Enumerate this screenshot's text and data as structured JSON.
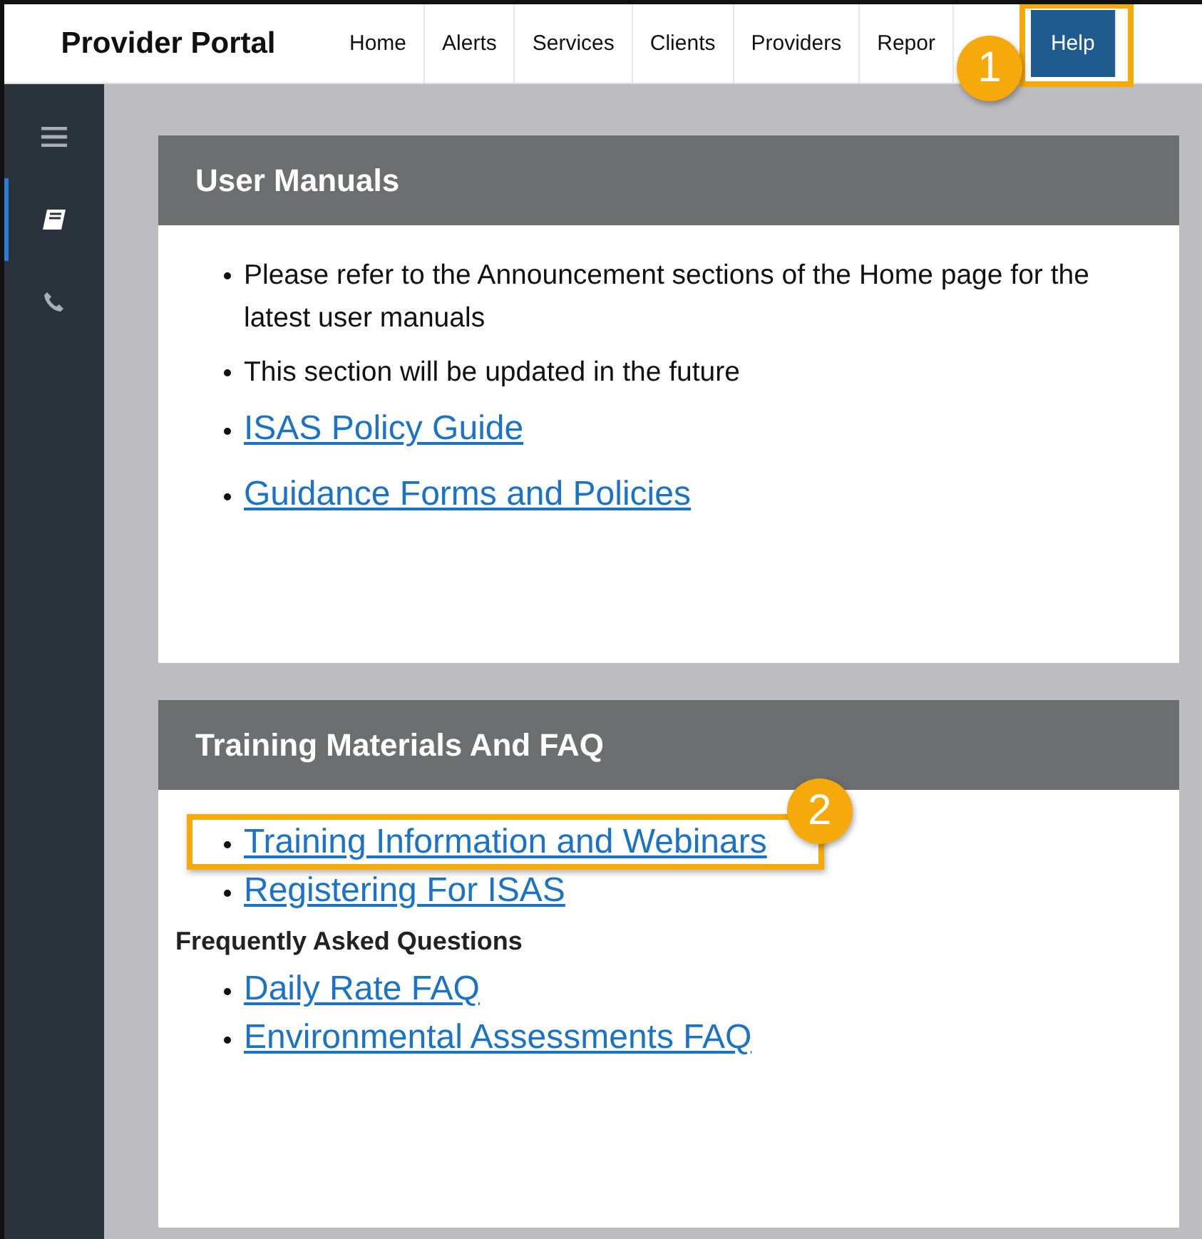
{
  "header": {
    "title": "Provider Portal"
  },
  "nav": [
    {
      "label": "Home",
      "selected": false
    },
    {
      "label": "Alerts",
      "selected": false
    },
    {
      "label": "Services",
      "selected": false
    },
    {
      "label": "Clients",
      "selected": false
    },
    {
      "label": "Providers",
      "selected": false
    },
    {
      "label": "Repor",
      "selected": false
    },
    {
      "label": "Help",
      "selected": true,
      "callout": "1"
    }
  ],
  "sidebar": {
    "items": [
      {
        "kind": "menu",
        "selected": false
      },
      {
        "kind": "book",
        "selected": true
      },
      {
        "kind": "phone",
        "selected": false
      }
    ]
  },
  "cards": [
    {
      "title": "User Manuals",
      "items": [
        {
          "kind": "text",
          "text": "Please refer to the Announcement sections of the Home page for the latest user manuals"
        },
        {
          "kind": "text",
          "text": "This section will be updated in the future"
        },
        {
          "kind": "link",
          "text": "ISAS Policy Guide"
        },
        {
          "kind": "link",
          "text": "Guidance Forms and Policies"
        }
      ]
    },
    {
      "title": "Training Materials And FAQ",
      "items": [
        {
          "kind": "link",
          "text": "Training Information and Webinars",
          "callout": "2"
        },
        {
          "kind": "link",
          "text": "Registering For ISAS"
        },
        {
          "kind": "heading",
          "text": "Frequently Asked Questions"
        },
        {
          "kind": "link",
          "text": "Daily Rate FAQ"
        },
        {
          "kind": "link",
          "text": "Environmental Assessments FAQ"
        }
      ]
    }
  ]
}
